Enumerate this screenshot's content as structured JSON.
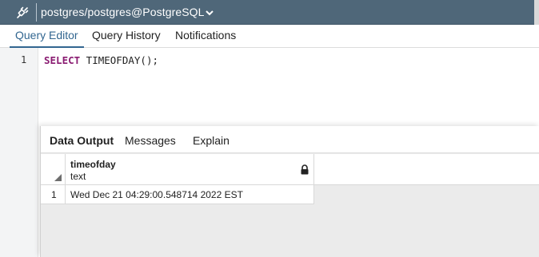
{
  "connection": {
    "icon": "plug-icon",
    "label": "postgres/postgres@PostgreSQL",
    "dropdown_icon": "chevron-down-icon"
  },
  "tabs": [
    {
      "label": "Query Editor",
      "active": true
    },
    {
      "label": "Query History",
      "active": false
    },
    {
      "label": "Notifications",
      "active": false
    }
  ],
  "editor": {
    "line_number": "1",
    "keyword": "SELECT",
    "rest": " TIMEOFDAY();"
  },
  "results": {
    "tabs": [
      {
        "label": "Data Output",
        "active": true
      },
      {
        "label": "Messages",
        "active": false
      },
      {
        "label": "Explain",
        "active": false
      }
    ],
    "columns": [
      {
        "name": "timeofday",
        "type": "text",
        "icon": "lock-icon"
      }
    ],
    "rows": [
      {
        "num": "1",
        "cells": [
          "Wed Dec 21 04:29:00.548714 2022 EST"
        ]
      }
    ]
  },
  "colors": {
    "topbar": "#4f6779",
    "active_tab": "#326690",
    "keyword": "#8a1c72"
  }
}
